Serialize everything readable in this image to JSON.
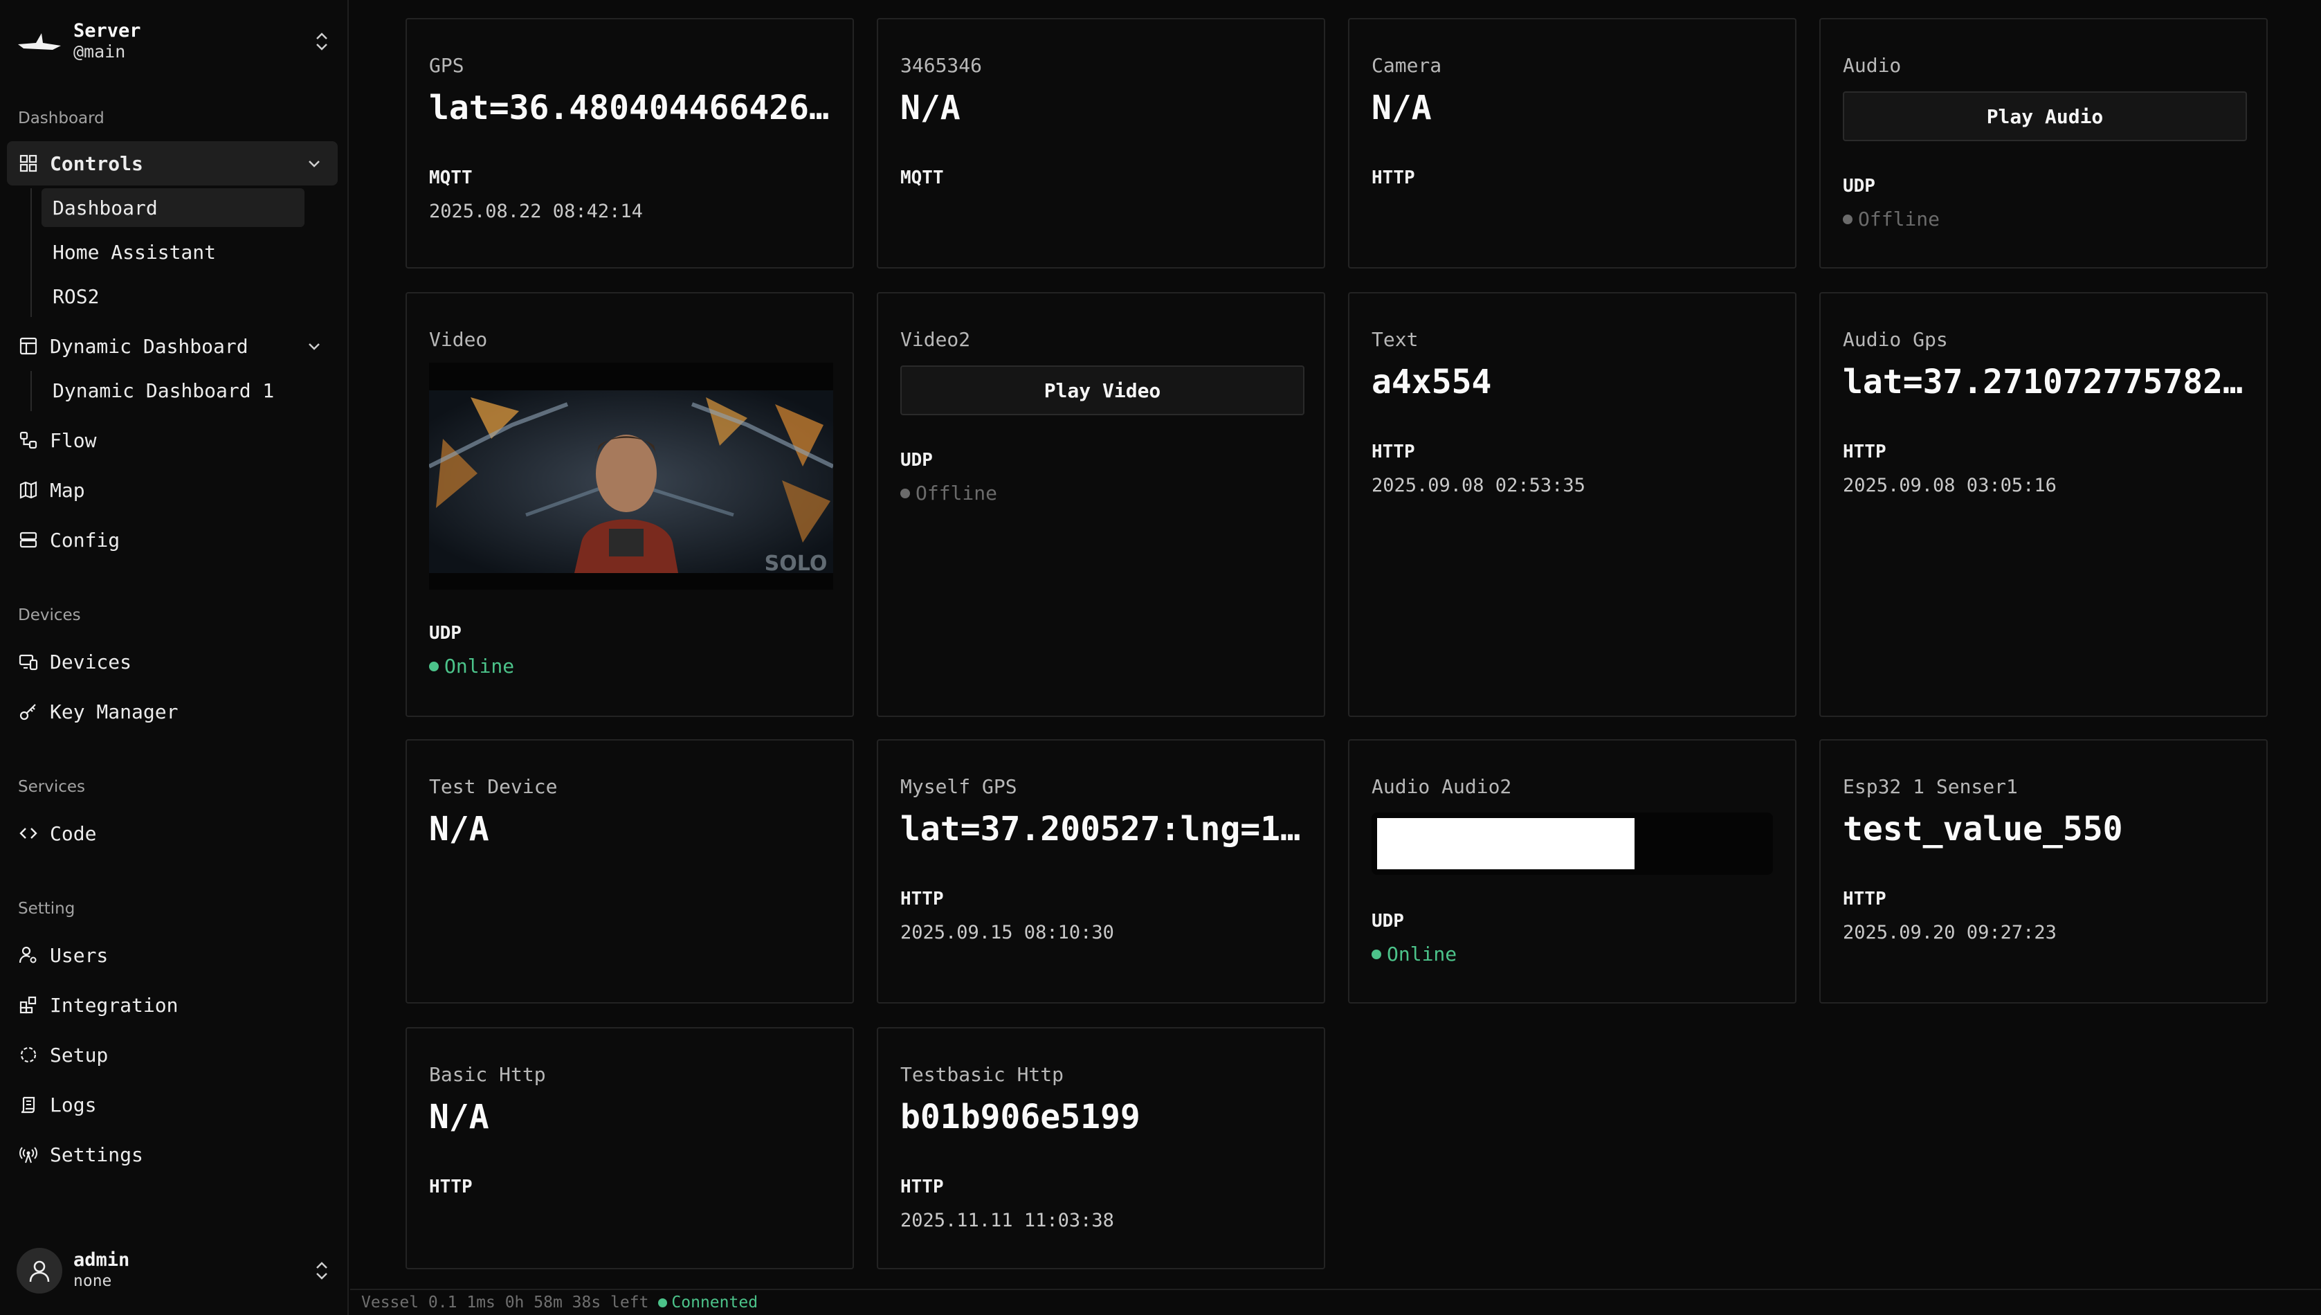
{
  "workspace": {
    "name": "Server",
    "branch": "@main"
  },
  "sidebar": {
    "groups": {
      "dashboard": "Dashboard",
      "devices": "Devices",
      "services": "Services",
      "setting": "Setting"
    },
    "controls": {
      "label": "Controls",
      "children": [
        "Dashboard",
        "Home Assistant",
        "ROS2"
      ]
    },
    "dynamic": {
      "label": "Dynamic Dashboard",
      "children": [
        "Dynamic Dashboard 1"
      ]
    },
    "items": {
      "flow": "Flow",
      "map": "Map",
      "config": "Config",
      "devices": "Devices",
      "key_manager": "Key Manager",
      "code": "Code",
      "users": "Users",
      "integration": "Integration",
      "setup": "Setup",
      "logs": "Logs",
      "settings": "Settings"
    }
  },
  "user": {
    "name": "admin",
    "role": "none"
  },
  "cards": {
    "gps": {
      "label": "GPS",
      "value": "lat=36.480404466426…",
      "protocol": "MQTT",
      "time": "2025.08.22 08:42:14"
    },
    "c3465346": {
      "label": "3465346",
      "value": "N/A",
      "protocol": "MQTT"
    },
    "camera": {
      "label": "Camera",
      "value": "N/A",
      "protocol": "HTTP"
    },
    "audio": {
      "label": "Audio",
      "button": "Play Audio",
      "protocol": "UDP",
      "status": "Offline"
    },
    "video": {
      "label": "Video",
      "protocol": "UDP",
      "status": "Online",
      "watermark": "SOLO"
    },
    "video2": {
      "label": "Video2",
      "button": "Play Video",
      "protocol": "UDP",
      "status": "Offline"
    },
    "text": {
      "label": "Text",
      "value": "a4x554",
      "protocol": "HTTP",
      "time": "2025.09.08 02:53:35"
    },
    "audio_gps": {
      "label": "Audio Gps",
      "value": "lat=37.271072775782…",
      "protocol": "HTTP",
      "time": "2025.09.08 03:05:16"
    },
    "test_device": {
      "label": "Test Device",
      "value": "N/A"
    },
    "myself_gps": {
      "label": "Myself GPS",
      "value": "lat=37.200527:lng=1…",
      "protocol": "HTTP",
      "time": "2025.09.15 08:10:30"
    },
    "audio_audio2": {
      "label": "Audio Audio2",
      "level": 0.66,
      "protocol": "UDP",
      "status": "Online"
    },
    "esp32": {
      "label": "Esp32 1 Senser1",
      "value": "test_value_550",
      "protocol": "HTTP",
      "time": "2025.09.20 09:27:23"
    },
    "basic_http": {
      "label": "Basic Http",
      "value": "N/A",
      "protocol": "HTTP"
    },
    "testbasic_http": {
      "label": "Testbasic Http",
      "value": "b01b906e5199",
      "protocol": "HTTP",
      "time": "2025.11.11 11:03:38"
    }
  },
  "statusbar": {
    "text": "Vessel 0.1 1ms 0h 58m 38s left",
    "connection": "Connented"
  },
  "colors": {
    "online": "#4cc38a",
    "offline": "#6b6b6b",
    "background": "#0a0a0a",
    "card_border": "#232323"
  }
}
